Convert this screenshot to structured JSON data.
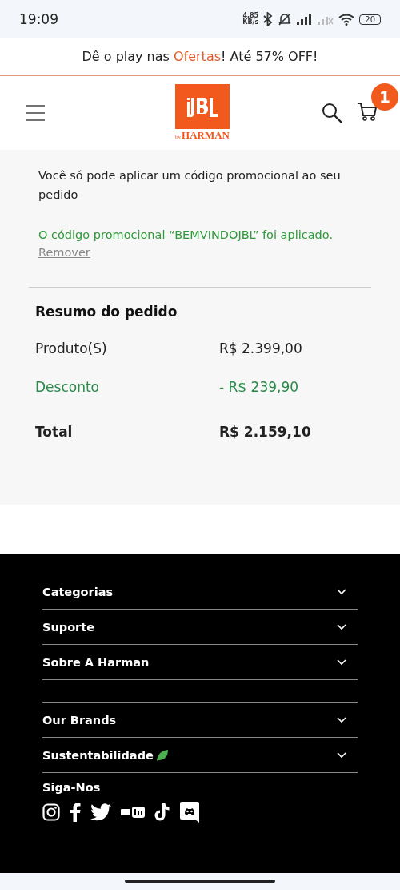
{
  "status_bar": {
    "time": "19:09",
    "speed_value": "4,85",
    "speed_unit": "KB/s",
    "battery": "20"
  },
  "promo_banner": {
    "before": "Dê o play nas ",
    "link": "Ofertas",
    "after": "! Até 57% OFF!"
  },
  "header": {
    "logo_sub": "by",
    "logo_brand": "HARMAN",
    "cart_count": "1"
  },
  "promo_code": {
    "note": "Você só pode aplicar um código promocional ao seu pedido",
    "applied": "O código promocional “BEMVINDOJBL” foi aplicado.",
    "remove": "Remover"
  },
  "order_summary": {
    "title": "Resumo do pedido",
    "rows": [
      {
        "kind": "normal",
        "label": "Produto(S)",
        "value": "R$ 2.399,00"
      },
      {
        "kind": "discount",
        "label": "Desconto",
        "value": "- R$ 239,90"
      },
      {
        "kind": "total",
        "label": "Total",
        "value": "R$ 2.159,10"
      }
    ]
  },
  "footer": {
    "groups": [
      [
        {
          "label": "Categorias",
          "expanded": false,
          "leaf": false
        },
        {
          "label": "Suporte",
          "expanded": false,
          "leaf": false
        },
        {
          "label": "Sobre A Harman",
          "expanded": false,
          "leaf": false
        }
      ],
      [
        {
          "label": "Our Brands",
          "expanded": false,
          "leaf": false
        },
        {
          "label": "Sustentabilidade",
          "expanded": false,
          "leaf": true
        }
      ]
    ],
    "follow_title": "Siga-Nos",
    "socials": [
      {
        "kind": "instagram"
      },
      {
        "kind": "facebook"
      },
      {
        "kind": "twitter"
      },
      {
        "kind": "youtube"
      },
      {
        "kind": "tiktok"
      },
      {
        "kind": "discord"
      }
    ]
  }
}
